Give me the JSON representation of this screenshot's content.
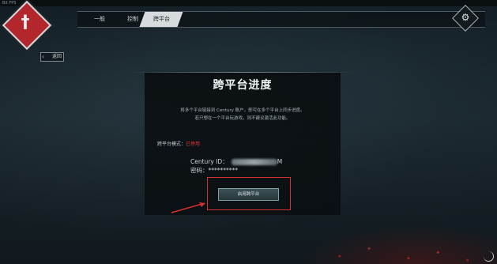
{
  "window": {
    "title": "Bit FPS"
  },
  "tabs": [
    {
      "label": "一般"
    },
    {
      "label": "控制"
    },
    {
      "label": "跨平台"
    }
  ],
  "back_label": "返回",
  "main": {
    "title": "跨平台进度",
    "desc_line1": "将多个平台链接到 Century 账户，即可在多个平台上同步进度。",
    "desc_line2": "若只想在一个平台玩游戏，则不建议激活此功能。",
    "mode_label": "跨平台模式：",
    "mode_value": "已停用",
    "century_id_label": "Century ID：",
    "century_id_suffix": "M",
    "password_label": "密码：",
    "password_value": "**********",
    "button_label": "启用跨平台"
  },
  "colors": {
    "accent_red": "#d9302f",
    "logo_red": "#b3262b"
  }
}
